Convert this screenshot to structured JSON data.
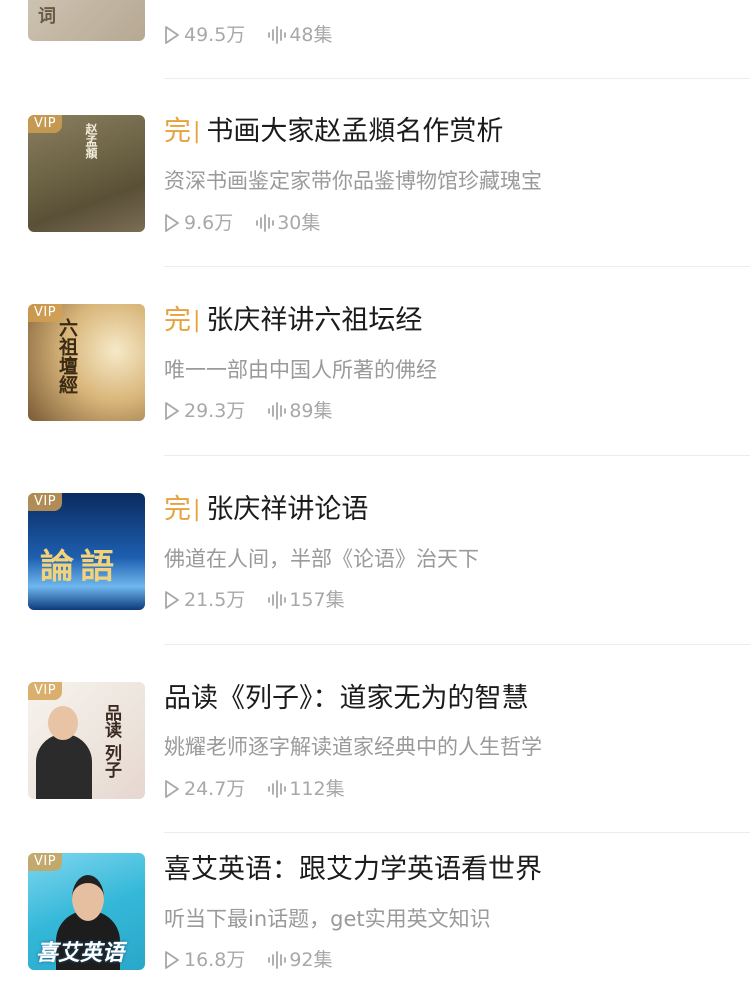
{
  "items": [
    {
      "title": "",
      "done_label": "",
      "desc": "",
      "plays": "49.5万",
      "episodes": "48集",
      "thumb_text": "词",
      "partial": true
    },
    {
      "title": "书画大家赵孟頫名作赏析",
      "done_label": "完",
      "done_bar": "|",
      "desc": "资深书画鉴定家带你品鉴博物馆珍藏瑰宝",
      "plays": "9.6万",
      "episodes": "30集",
      "vip": "VIP",
      "thumb_text": "赵孟頫"
    },
    {
      "title": "张庆祥讲六祖坛经",
      "done_label": "完",
      "done_bar": "|",
      "desc": "唯一一部由中国人所著的佛经",
      "plays": "29.3万",
      "episodes": "89集",
      "vip": "VIP",
      "thumb_text": "六祖壇經"
    },
    {
      "title": "张庆祥讲论语",
      "done_label": "完",
      "done_bar": "|",
      "desc": "佛道在人间，半部《论语》治天下",
      "plays": "21.5万",
      "episodes": "157集",
      "vip": "VIP",
      "thumb_text": "論語"
    },
    {
      "title": "品读《列子》：道家无为的智慧",
      "desc": "姚耀老师逐字解读道家经典中的人生哲学",
      "plays": "24.7万",
      "episodes": "112集",
      "vip": "VIP",
      "thumb_text": "品读 列子"
    },
    {
      "title": "喜艾英语：跟艾力学英语看世界",
      "desc": "听当下最in话题，get实用英文知识",
      "plays": "16.8万",
      "episodes": "92集",
      "vip": "VIP",
      "thumb_text": "喜艾英语"
    }
  ],
  "colors": {
    "accent": "#e6a23c",
    "title": "#1b1b1b",
    "meta": "#a8a8a8"
  },
  "icons": {
    "plays": "play-outline-icon",
    "episodes": "audio-wave-icon"
  }
}
